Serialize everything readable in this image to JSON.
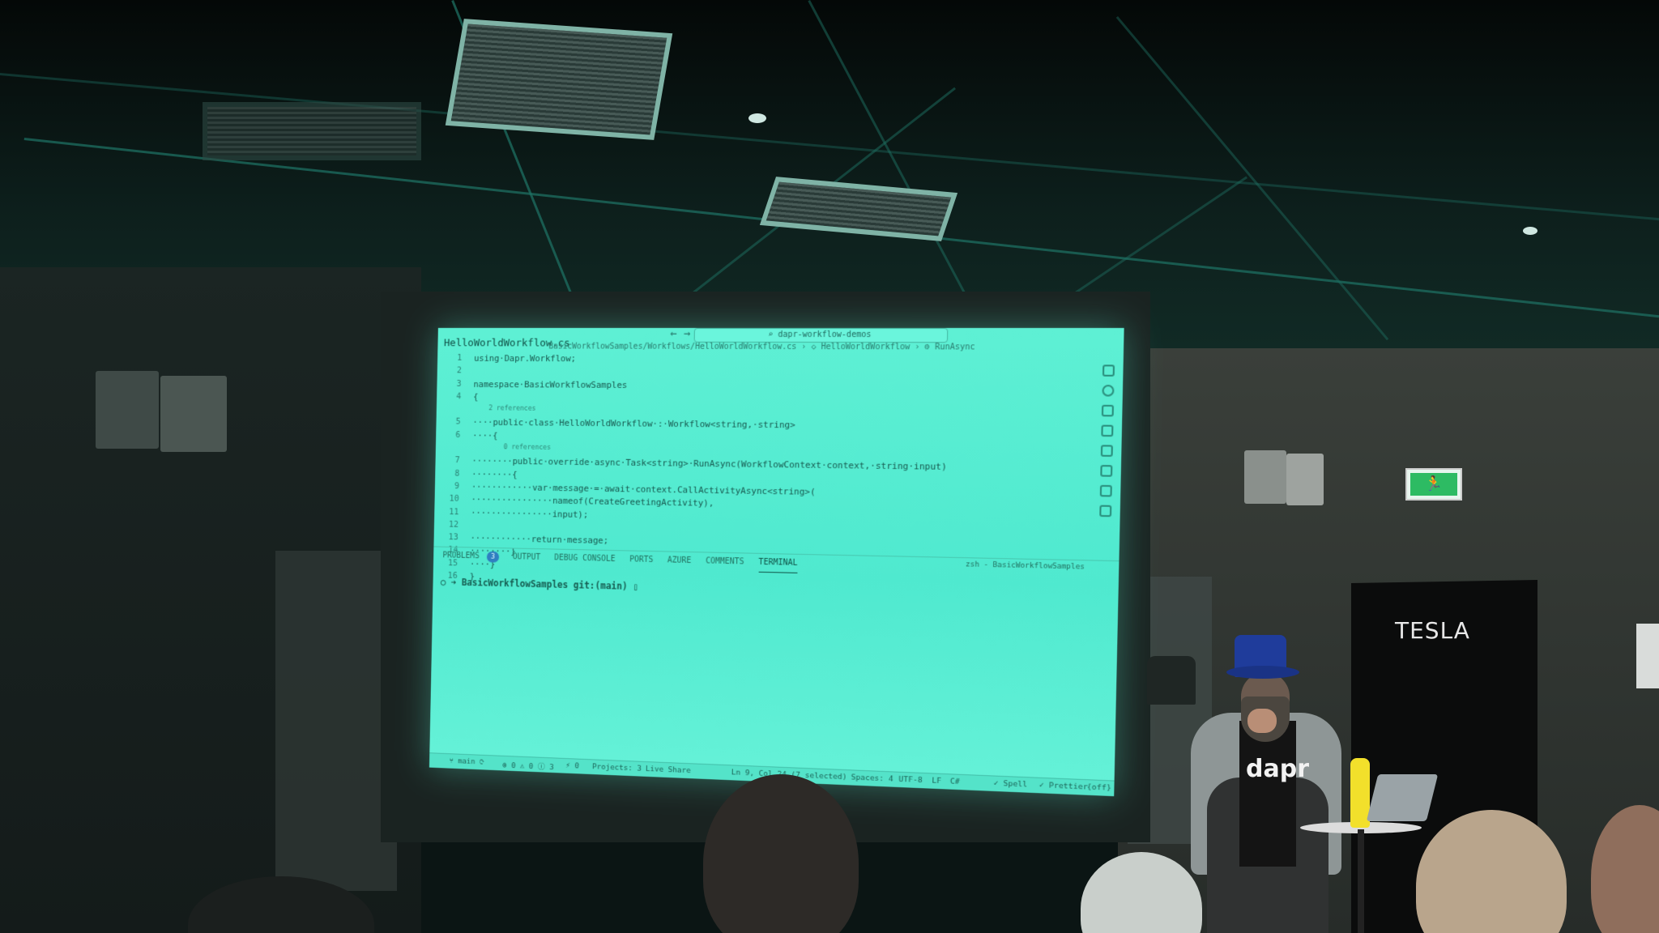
{
  "scene": {
    "door_sign": "TESLA",
    "presenter_shirt_logo": "dapr"
  },
  "editor": {
    "nav_back": "←",
    "nav_forward": "→",
    "command_center": "⌕ dapr-workflow-demos",
    "file_tab": "HelloWorldWorkflow.cs",
    "breadcrumb": "BasicWorkflowSamples/Workflows/HelloWorldWorkflow.cs  ›  ◇ HelloWorldWorkflow  ›  ⚙ RunAsync",
    "line_numbers": [
      "1",
      "2",
      "3",
      "4",
      "",
      "5",
      "6",
      "",
      "7",
      "8",
      "9",
      "10",
      "11",
      "12",
      "13",
      "14",
      "15",
      "16"
    ],
    "code_lines": [
      "using·Dapr.Workflow;",
      "",
      "namespace·BasicWorkflowSamples",
      "{",
      "    2 references",
      "····public·class·HelloWorldWorkflow·:·Workflow<string,·string>",
      "····{",
      "        0 references",
      "········public·override·async·Task<string>·RunAsync(WorkflowContext·context,·string·input)",
      "········{",
      "············var·message·=·await·context.CallActivityAsync<string>(",
      "················nameof(CreateGreetingActivity),",
      "················input);",
      "",
      "············return·message;",
      "········}",
      "····}",
      "}"
    ],
    "panel_tabs": {
      "problems": "PROBLEMS",
      "problems_count": "3",
      "output": "OUTPUT",
      "debug_console": "DEBUG CONSOLE",
      "ports": "PORTS",
      "azure": "AZURE",
      "comments": "COMMENTS",
      "terminal": "TERMINAL"
    },
    "terminal_title": "zsh - BasicWorkflowSamples",
    "terminal_prompt": "○ ➜  BasicWorkflowSamples git:(main) ▯",
    "status": {
      "branch": "⑂ main ⟳",
      "errors": "⊗ 0 ⚠ 0 ⓘ 3",
      "ports": "⚡ 0",
      "projects": "Projects: 3",
      "live_share": "Live Share",
      "position": "Ln 9, Col 24 (7 selected)",
      "spaces": "Spaces: 4",
      "encoding": "UTF-8",
      "eol": "LF",
      "language": "C#",
      "spell": "✓ Spell",
      "prettier": "✓ Prettier",
      "off": "{off}"
    }
  }
}
